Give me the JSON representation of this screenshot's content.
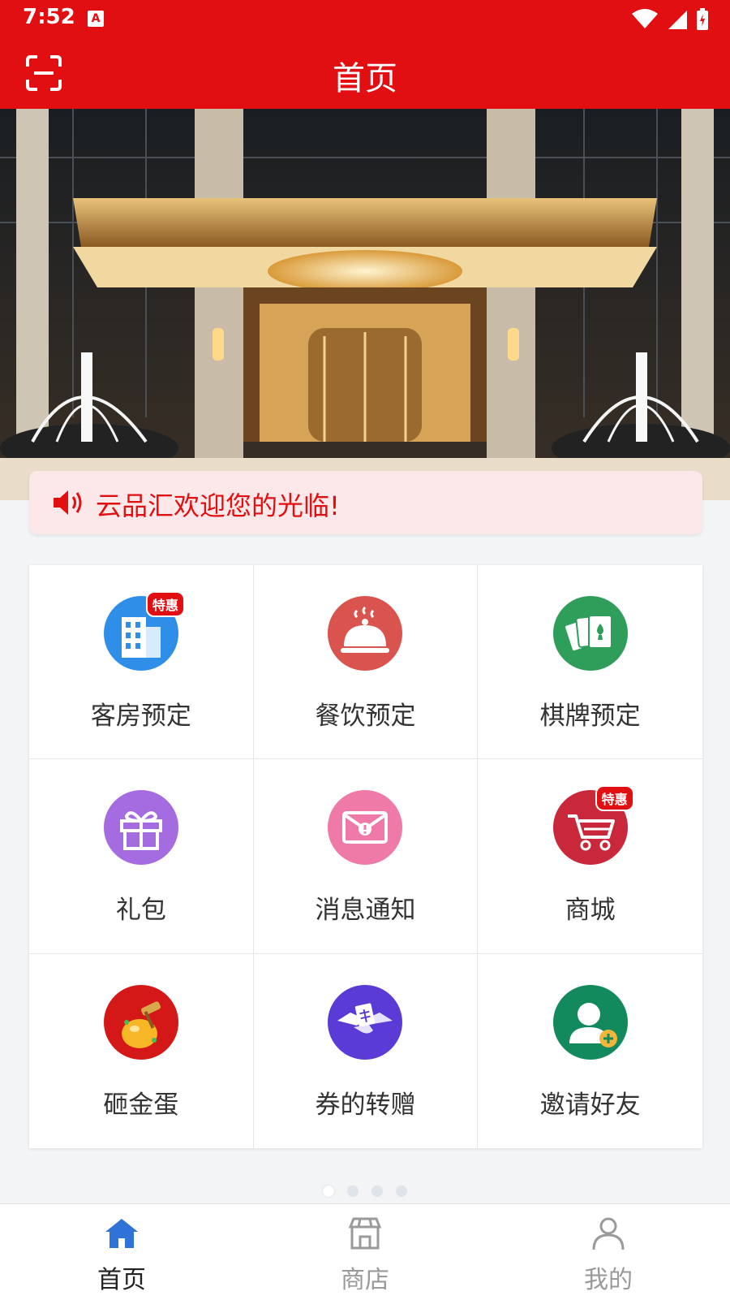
{
  "status": {
    "time": "7:52",
    "a_icon": "A"
  },
  "header": {
    "title": "首页"
  },
  "notice": {
    "text": "云品汇欢迎您的光临!"
  },
  "menu": [
    {
      "label": "客房预定",
      "icon": "hotel-building-icon",
      "badge": "特惠",
      "color": "#2f8ee8"
    },
    {
      "label": "餐饮预定",
      "icon": "food-cloche-icon",
      "badge": "",
      "color": "#d9534f"
    },
    {
      "label": "棋牌预定",
      "icon": "playing-cards-icon",
      "badge": "",
      "color": "#2f9e5a"
    },
    {
      "label": "礼包",
      "icon": "gift-box-icon",
      "badge": "",
      "color": "#a56be0"
    },
    {
      "label": "消息通知",
      "icon": "envelope-icon",
      "badge": "",
      "color": "#ef7aa7"
    },
    {
      "label": "商城",
      "icon": "shopping-cart-icon",
      "badge": "特惠",
      "color": "#c8283a"
    },
    {
      "label": "砸金蛋",
      "icon": "golden-egg-icon",
      "badge": "",
      "color": "#d41818"
    },
    {
      "label": "券的转赠",
      "icon": "handshake-coupon-icon",
      "badge": "",
      "color": "#5b3bd6"
    },
    {
      "label": "邀请好友",
      "icon": "add-friend-icon",
      "badge": "",
      "color": "#128a5e"
    }
  ],
  "carousel": {
    "total": 4,
    "active": 1
  },
  "tabs": [
    {
      "label": "首页",
      "icon": "home-icon",
      "active": true
    },
    {
      "label": "商店",
      "icon": "store-icon",
      "active": false
    },
    {
      "label": "我的",
      "icon": "profile-icon",
      "active": false
    }
  ]
}
